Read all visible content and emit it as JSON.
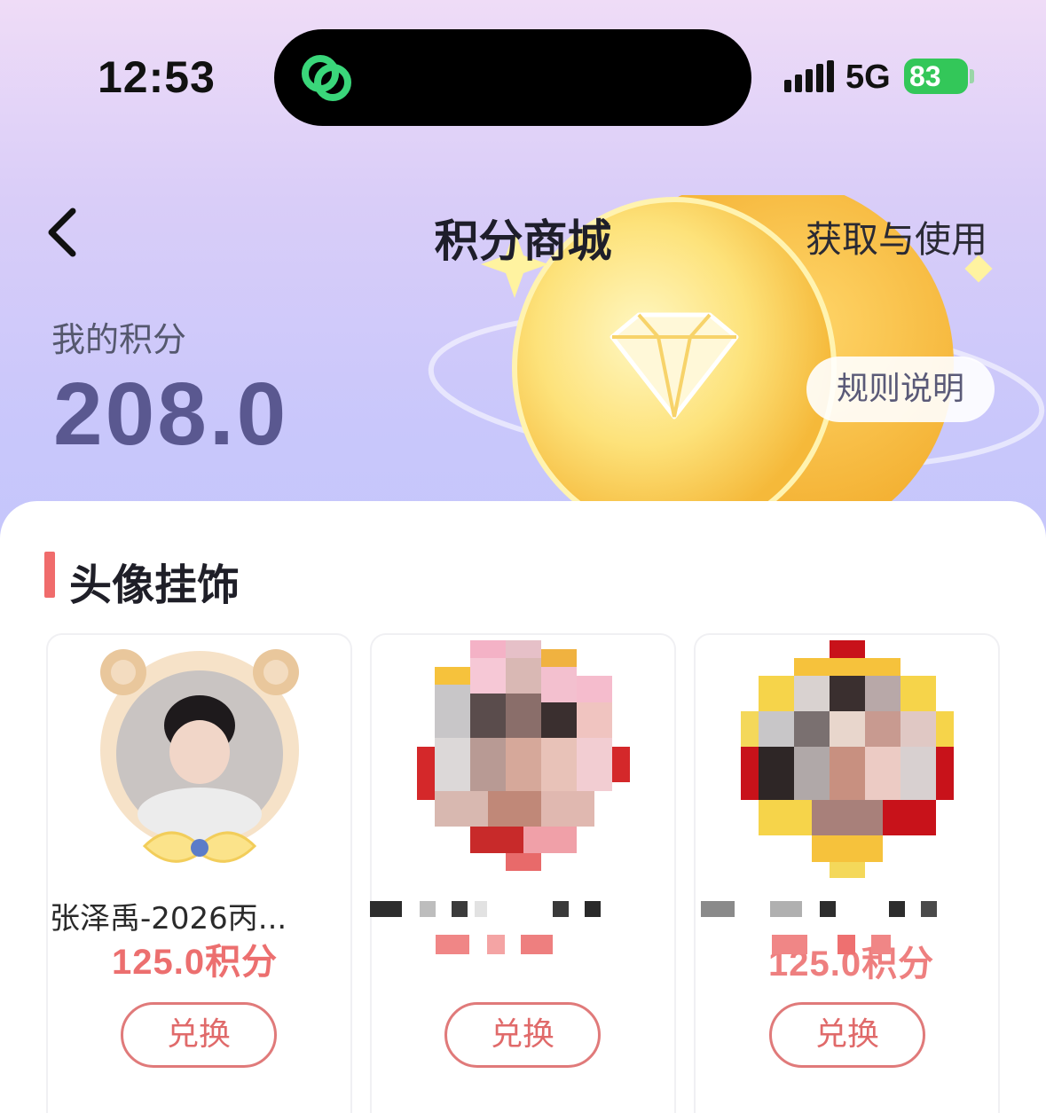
{
  "status_bar": {
    "time": "12:53",
    "network": "5G",
    "battery": "83",
    "island_icon": "link-rings-icon"
  },
  "header": {
    "back_icon": "chevron-left-icon",
    "title": "积分商城",
    "get_and_use_link": "获取与使用"
  },
  "points": {
    "label": "我的积分",
    "value": "208.0",
    "rules_button": "规则说明"
  },
  "section": {
    "title": "头像挂饰"
  },
  "items": [
    {
      "name": "张泽禹-2026丙...",
      "price": "125.0积分",
      "redeem_label": "兑换"
    },
    {
      "name": "",
      "price": "",
      "redeem_label": "兑换"
    },
    {
      "name": "",
      "price": "125.0积分",
      "redeem_label": "兑换"
    }
  ],
  "colors": {
    "accent_red": "#ec6f6f",
    "points_purple": "#5a5890",
    "battery_green": "#33c759",
    "coin_gold": "#fcd34d"
  }
}
